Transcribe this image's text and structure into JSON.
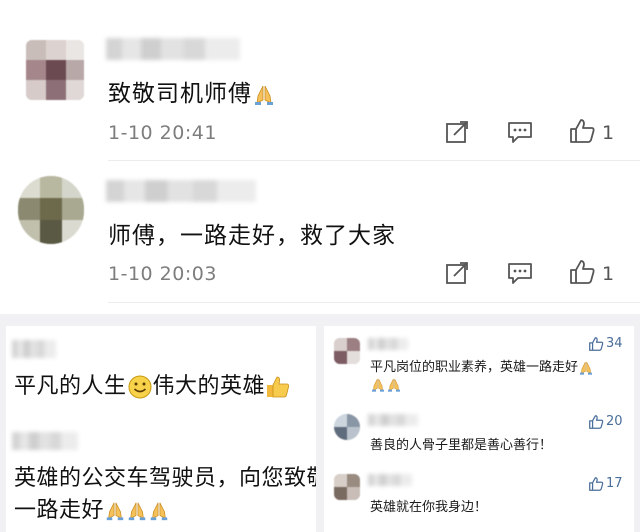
{
  "top_comments": [
    {
      "text": "致敬司机师傅",
      "emoji": "praying-hands",
      "time": "1-10 20:41",
      "likes": "1"
    },
    {
      "text": "师傅，一路走好，救了大家",
      "time": "1-10 20:03",
      "likes": "1"
    }
  ],
  "bottom_left": {
    "line1_a": "平凡的人生",
    "line1_b": "伟大的英雄",
    "line2": "英雄的公交车驾驶员，向您致敬",
    "line3": "一路走好"
  },
  "bottom_right": [
    {
      "text": "平凡岗位的职业素养，英雄一路走好",
      "likes": "34"
    },
    {
      "text": "善良的人骨子里都是善心善行！",
      "likes": "20"
    },
    {
      "text": "英雄就在你我身边！",
      "likes": "17"
    }
  ],
  "colors": {
    "background": "#ffffff",
    "panel_bg": "#f1f1f3",
    "meta_gray": "#7d7d7d",
    "like_blue": "#4a6e9a"
  }
}
